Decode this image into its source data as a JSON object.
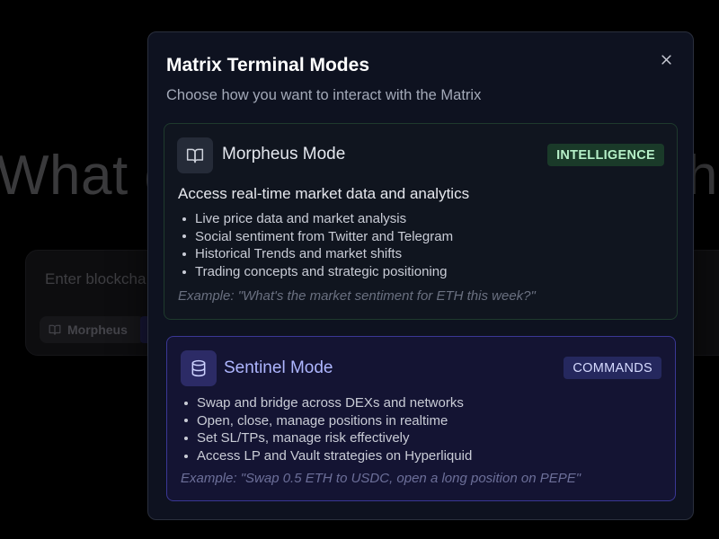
{
  "background": {
    "heading_left": "What d",
    "heading_right": "ha",
    "input_placeholder": "Enter blockcha",
    "mode_chip_label": "Morpheus"
  },
  "modal": {
    "title": "Matrix Terminal Modes",
    "subtitle": "Choose how you want to interact with the Matrix",
    "close_icon": "close-icon"
  },
  "modes": [
    {
      "name": "Morpheus Mode",
      "badge": "INTELLIGENCE",
      "icon": "book-open-icon",
      "description": "Access real-time market data and analytics",
      "features": [
        "Live price data and market analysis",
        "Social sentiment from Twitter and Telegram",
        "Historical Trends and market shifts",
        "Trading concepts and strategic positioning"
      ],
      "example": "Example: \"What's the market sentiment for ETH this week?\"",
      "accent": "#1e3a2d"
    },
    {
      "name": "Sentinel Mode",
      "badge": "COMMANDS",
      "icon": "database-icon",
      "features": [
        "Swap and bridge across DEXs and networks",
        "Open, close, manage positions in realtime",
        "Set SL/TPs, manage risk effectively",
        "Access LP and Vault strategies on Hyperliquid"
      ],
      "example": "Example: \"Swap 0.5 ETH to USDC, open a long position on PEPE\"",
      "accent": "#3a3794"
    }
  ]
}
